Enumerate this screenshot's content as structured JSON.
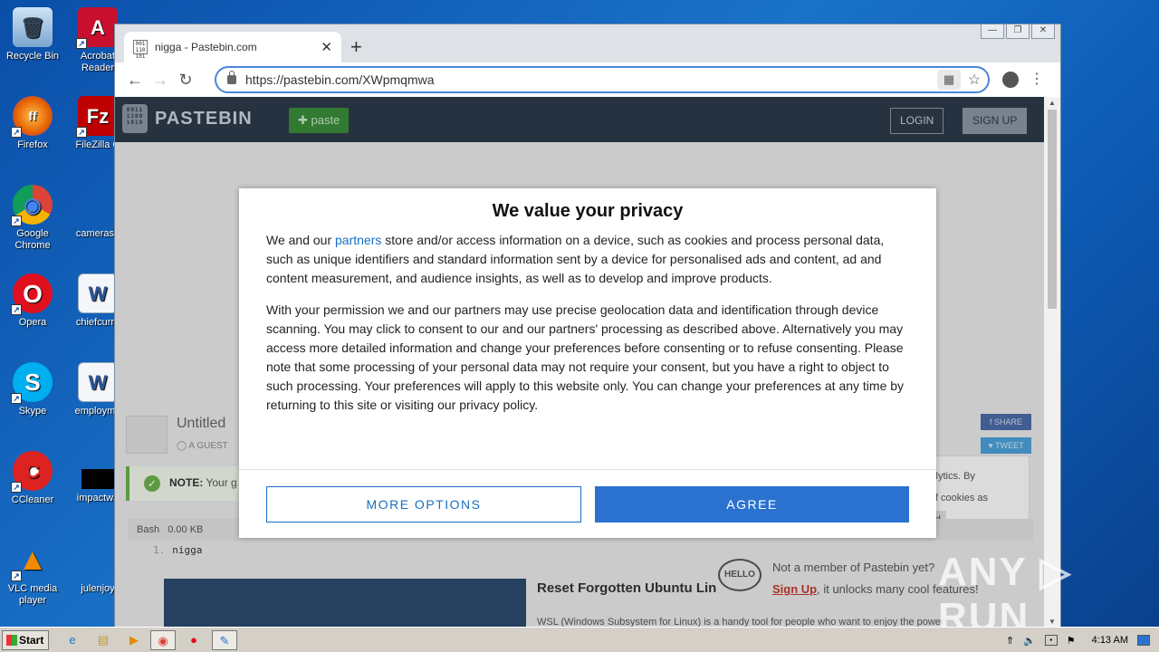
{
  "desktop": {
    "icons": [
      {
        "label": "Recycle Bin",
        "glyph": "🗑"
      },
      {
        "label": "Acrobat Reader",
        "glyph": "A"
      },
      {
        "label": "Firefox",
        "glyph": "ff"
      },
      {
        "label": "FileZilla C",
        "glyph": "Fz"
      },
      {
        "label": "Google Chrome",
        "glyph": "◉"
      },
      {
        "label": "cameraso",
        "glyph": ""
      },
      {
        "label": "Opera",
        "glyph": "O"
      },
      {
        "label": "chiefcurre",
        "glyph": "W"
      },
      {
        "label": "Skype",
        "glyph": "S"
      },
      {
        "label": "employme",
        "glyph": "W"
      },
      {
        "label": "CCleaner",
        "glyph": "C"
      },
      {
        "label": "impactwa",
        "glyph": ""
      },
      {
        "label": "VLC media player",
        "glyph": "▲"
      },
      {
        "label": "julenjoy",
        "glyph": ""
      }
    ]
  },
  "browser": {
    "tab_title": "nigga - Pastebin.com",
    "favicon_text": "001 110 101",
    "new_tab_symbol": "+",
    "url": "https://pastebin.com/XWpmqmwa",
    "window_buttons": [
      "—",
      "❐",
      "✕"
    ]
  },
  "pastebin": {
    "logo_text": "PASTEBIN",
    "logo_mark": "0011 1100 1010",
    "paste_button": "paste",
    "login": "LOGIN",
    "signup": "SIGN UP",
    "paste_title": "Untitled",
    "author": "A GUEST",
    "note_label": "NOTE:",
    "note_text": " Your g",
    "syntax": "Bash",
    "size": "0.00 KB",
    "line_number": "1.",
    "code_line": "nigga",
    "share": "SHARE",
    "tweet": "TWEET",
    "cookie_text_1": "g analytics. By",
    "cookie_text_2": "use of cookies as",
    "cookie_understand": "stand",
    "related_title": "Reset Forgotten Ubuntu Lin",
    "related_desc": "WSL (Windows Subsystem for Linux) is a handy tool for people who want to enjoy the power",
    "member_prompt": "Not a member of Pastebin yet?",
    "member_signup": "Sign Up",
    "member_rest": ", it unlocks many cool features!",
    "hello_badge": "HELLO"
  },
  "privacy_dialog": {
    "title": "We value your privacy",
    "p1_before": "We and our ",
    "p1_link": "partners",
    "p1_after": " store and/or access information on a device, such as cookies and process personal data, such as unique identifiers and standard information sent by a device for personalised ads and content, ad and content measurement, and audience insights, as well as to develop and improve products.",
    "p2": "With your permission we and our partners may use precise geolocation data and identification through device scanning. You may click to consent to our and our partners' processing as described above. Alternatively you may access more detailed information and change your preferences before consenting or to refuse consenting. Please note that some processing of your personal data may not require your consent, but you have a right to object to such processing. Your preferences will apply to this website only. You can change your preferences at any time by returning to this site or visiting our privacy policy.",
    "more_options": "MORE OPTIONS",
    "agree": "AGREE"
  },
  "watermark": "ANY ▷ RUN",
  "taskbar": {
    "start": "Start",
    "time": "4:13 AM"
  }
}
